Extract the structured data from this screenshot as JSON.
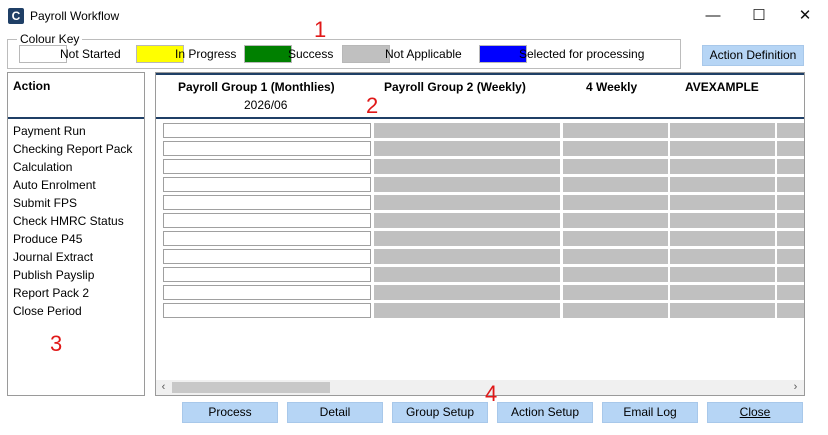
{
  "window": {
    "app_icon_letter": "C",
    "title": "Payroll Workflow",
    "controls": {
      "minimize": "—",
      "maximize": "☐",
      "close": "✕"
    }
  },
  "colour_key": {
    "legend": "Colour Key",
    "entries": [
      {
        "label": "Not Started",
        "color": "#ffffff"
      },
      {
        "label": "In Progress",
        "color": "#ffff00"
      },
      {
        "label": "Success",
        "color": "#008000"
      },
      {
        "label": "Not Applicable",
        "color": "#c0c0c0"
      },
      {
        "label": "Selected for processing",
        "color": "#0000ff"
      }
    ]
  },
  "action_definition_label": "Action Definition",
  "actions": {
    "header": "Action",
    "items": [
      "Payment Run",
      "Checking Report Pack",
      "Calculation",
      "Auto Enrolment",
      "Submit FPS",
      "Check HMRC Status",
      "Produce P45",
      "Journal Extract",
      "Publish Payslip",
      "Report Pack 2",
      "Close Period"
    ]
  },
  "grid": {
    "columns": [
      {
        "title": "Payroll Group 1 (Monthlies)",
        "subtitle": "2026/06",
        "cell_status": "Not Started"
      },
      {
        "title": "Payroll Group 2 (Weekly)",
        "subtitle": "",
        "cell_status": "Not Applicable"
      },
      {
        "title": "4 Weekly",
        "subtitle": "",
        "cell_status": "Not Applicable"
      },
      {
        "title": "AVEXAMPLE",
        "subtitle": "",
        "cell_status": "Not Applicable"
      },
      {
        "title": "",
        "subtitle": "",
        "cell_status": "Not Applicable"
      }
    ],
    "scroll_left_icon": "‹",
    "scroll_right_icon": "›"
  },
  "buttons": {
    "process": "Process",
    "detail": "Detail",
    "group_setup": "Group Setup",
    "action_setup": "Action Setup",
    "email_log": "Email Log",
    "close": "Close"
  },
  "annotations": [
    "1",
    "2",
    "3",
    "4"
  ]
}
